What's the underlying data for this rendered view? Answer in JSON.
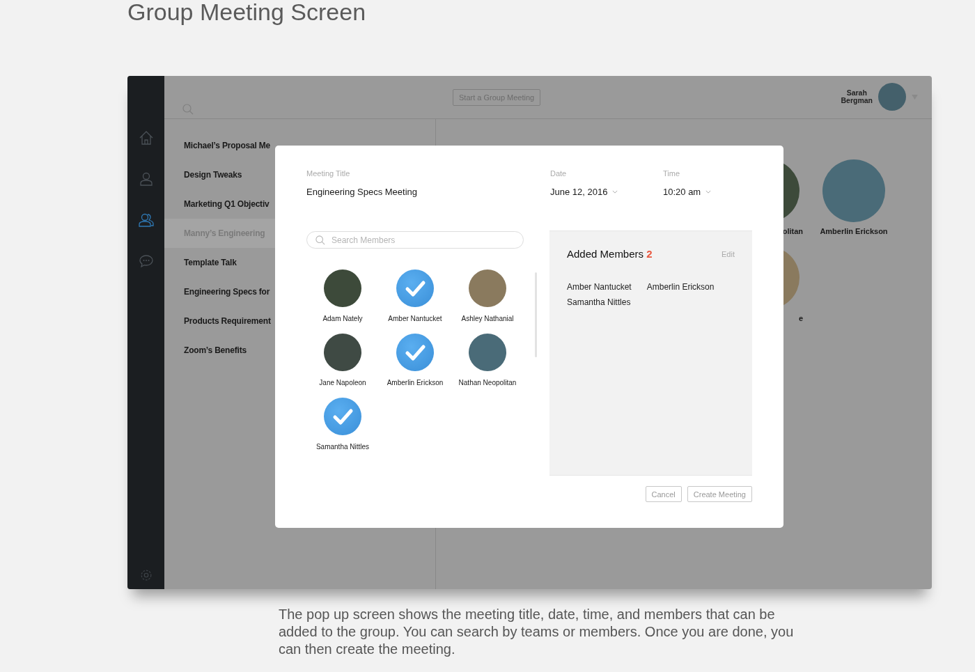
{
  "page_title": "Group Meeting Screen",
  "app": {
    "nav": [
      {
        "kind": "home",
        "selected": false
      },
      {
        "kind": "person",
        "selected": false
      },
      {
        "kind": "people",
        "selected": true
      },
      {
        "kind": "chat",
        "selected": false
      }
    ],
    "top_bar": {
      "button": "Start a Group Meeting",
      "user_first": "Sarah",
      "user_last": "Bergman"
    },
    "meetings": [
      {
        "title": "Michael’s Proposal Me",
        "selected": false
      },
      {
        "title": "Design Tweaks",
        "selected": false
      },
      {
        "title": "Marketing Q1 Objectiv",
        "selected": false
      },
      {
        "title": "Manny’s Engineering",
        "selected": true
      },
      {
        "title": "Template Talk",
        "selected": false
      },
      {
        "title": "Engineering Specs for",
        "selected": false
      },
      {
        "title": "Products Requirement",
        "selected": false
      },
      {
        "title": "Zoom’s Benefits",
        "selected": false
      }
    ],
    "background_members": [
      {
        "name": "olitan"
      },
      {
        "name": "Amberlin Erickson"
      },
      {
        "name": "e"
      }
    ]
  },
  "dialog": {
    "title_label": "Meeting Title",
    "title_value": "Engineering Specs Meeting",
    "date_label": "Date",
    "date_value": "June 12, 2016",
    "time_label": "Time",
    "time_value": "10:20 am",
    "search_placeholder": "Search Members",
    "members": [
      {
        "name": "Adam Nately",
        "selected": false
      },
      {
        "name": "Amber Nantucket",
        "selected": true
      },
      {
        "name": "Ashley Nathanial",
        "selected": false
      },
      {
        "name": "Jane Napoleon",
        "selected": false
      },
      {
        "name": "Amberlin Erickson",
        "selected": true
      },
      {
        "name": "Nathan Neopolitan",
        "selected": false
      },
      {
        "name": "Samantha Nittles",
        "selected": true
      }
    ],
    "added": {
      "heading": "Added Members",
      "count": "2",
      "edit": "Edit",
      "names": [
        "Amber Nantucket",
        "Amberlin Erickson",
        "Samantha Nittles"
      ]
    },
    "buttons": [
      "Cancel",
      "Create Meeting"
    ]
  },
  "caption": "The pop up screen shows the meeting title, date, time, and members that can be added to the group. You can search by teams or members. Once you are done, you can then create the meeting."
}
